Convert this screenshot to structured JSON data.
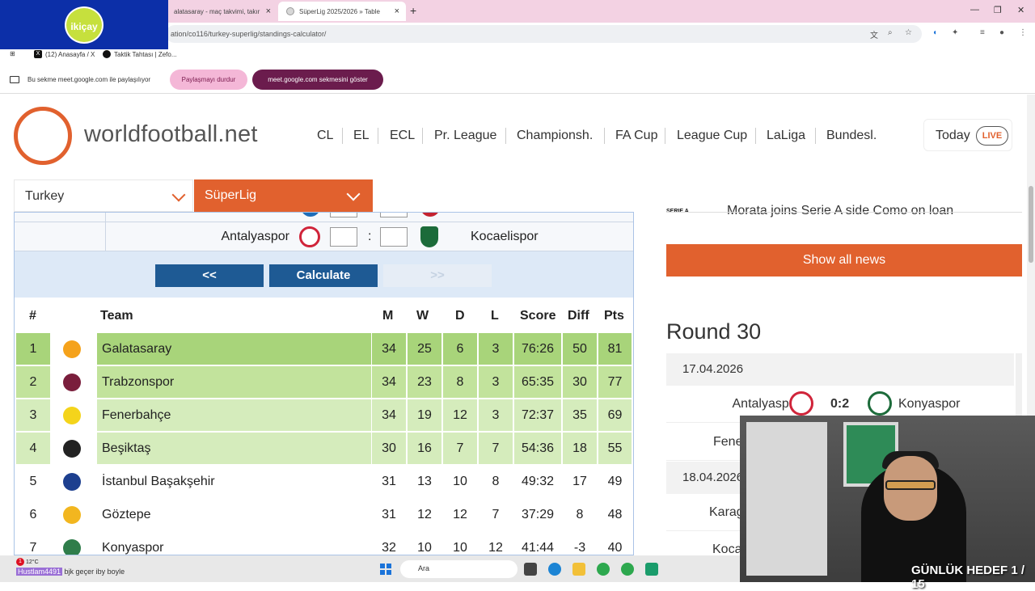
{
  "browser": {
    "tabs": [
      {
        "title": "alatasaray - maç takvimi, takır"
      },
      {
        "title": "SüperLig 2025/2026 » Table"
      }
    ],
    "url": "ation/co116/turkey-superlig/standings-calculator/",
    "bookmarks": [
      {
        "label": "(12) Anasayfa / X"
      },
      {
        "label": "Taktik Tahtası | Zefo..."
      }
    ],
    "share_text": "Bu sekme meet.google.com ile paylaşılıyor",
    "stop_button": "Paylaşmayı durdur",
    "show_button": "meet.google.com sekmesini göster",
    "overlay_logo": "ikiçay"
  },
  "site": {
    "logo_text": "worldfootball.net",
    "nav": [
      "CL",
      "EL",
      "ECL",
      "Pr. League",
      "Championsh.",
      "FA Cup",
      "League Cup",
      "LaLiga",
      "Bundesl."
    ],
    "today": "Today",
    "live": "LIVE",
    "country": "Turkey",
    "league": "SüperLig"
  },
  "calculator": {
    "match": {
      "home": "Antalyaspor",
      "away": "Kocaelispor",
      "colon": ":"
    },
    "prev": "<<",
    "calc": "Calculate",
    "next": ">>"
  },
  "table": {
    "headers": {
      "rank": "#",
      "team": "Team",
      "m": "M",
      "w": "W",
      "d": "D",
      "l": "L",
      "score": "Score",
      "diff": "Diff",
      "pts": "Pts"
    },
    "rows": [
      {
        "rank": "1",
        "team": "Galatasaray",
        "m": "34",
        "w": "25",
        "d": "6",
        "l": "3",
        "score": "76:26",
        "diff": "50",
        "pts": "81"
      },
      {
        "rank": "2",
        "team": "Trabzonspor",
        "m": "34",
        "w": "23",
        "d": "8",
        "l": "3",
        "score": "65:35",
        "diff": "30",
        "pts": "77"
      },
      {
        "rank": "3",
        "team": "Fenerbahçe",
        "m": "34",
        "w": "19",
        "d": "12",
        "l": "3",
        "score": "72:37",
        "diff": "35",
        "pts": "69"
      },
      {
        "rank": "4",
        "team": "Beşiktaş",
        "m": "30",
        "w": "16",
        "d": "7",
        "l": "7",
        "score": "54:36",
        "diff": "18",
        "pts": "55"
      },
      {
        "rank": "5",
        "team": "İstanbul Başakşehir",
        "m": "31",
        "w": "13",
        "d": "10",
        "l": "8",
        "score": "49:32",
        "diff": "17",
        "pts": "49"
      },
      {
        "rank": "6",
        "team": "Göztepe",
        "m": "31",
        "w": "12",
        "d": "12",
        "l": "7",
        "score": "37:29",
        "diff": "8",
        "pts": "48"
      },
      {
        "rank": "7",
        "team": "Konyaspor",
        "m": "32",
        "w": "10",
        "d": "10",
        "l": "12",
        "score": "41:44",
        "diff": "-3",
        "pts": "40"
      }
    ]
  },
  "sidebar": {
    "news_tag": "SERIE A",
    "news_title": "Morata joins Serie A side Como on loan",
    "show_all": "Show all news",
    "round": "Round 30",
    "date1": "17.04.2026",
    "result1": {
      "home": "Antalyaspor",
      "score": "0:2",
      "away": "Konyaspor"
    },
    "row2_home": "Fene",
    "date2": "18.04.2026",
    "row3_home": "Karag",
    "row4_home": "Koca"
  },
  "overlay": {
    "goal": "GÜNLÜK HEDEF 1 / 15",
    "weather_temp": "12°C",
    "weather_badge": "1",
    "chat_name": "Hustlam4491",
    "chat_msg": "bjk geçer iby boyle",
    "search": "Ara"
  },
  "colors": {
    "accent": "#e1612e",
    "nav_blue": "#1e5a94",
    "green_top": "#a8d47a",
    "green_light": "#d5ecbc",
    "green_mid": "#c2e39c"
  }
}
